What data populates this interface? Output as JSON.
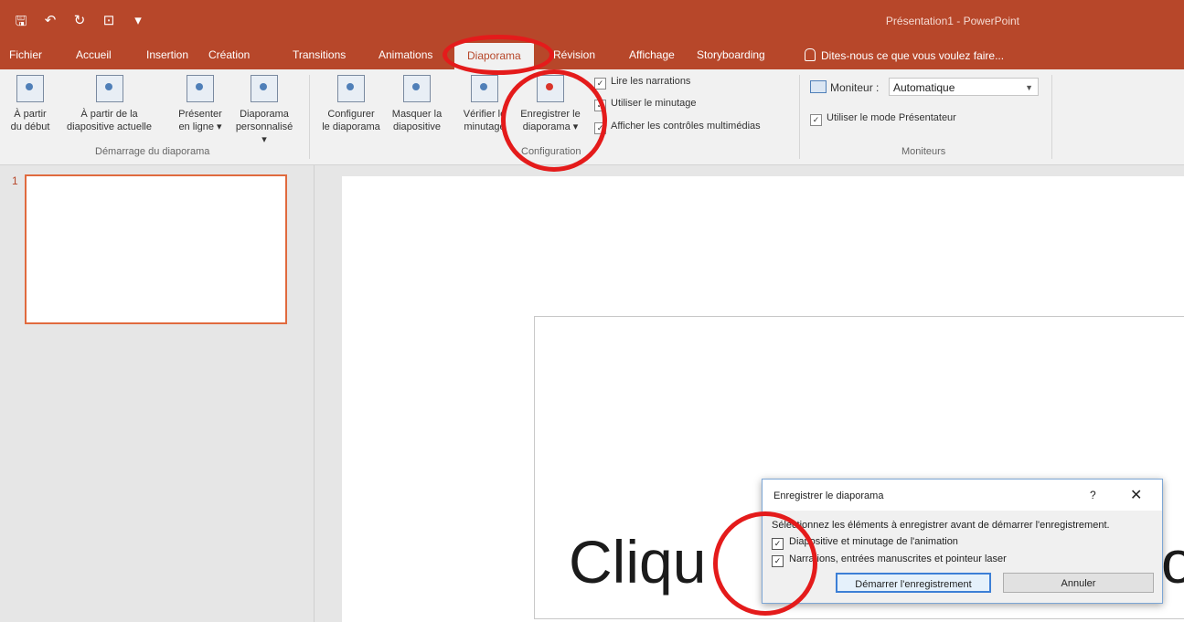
{
  "app": {
    "window_title": "Présentation1 - PowerPoint"
  },
  "qat": {
    "save_icon": "save-icon",
    "undo_icon": "undo-icon",
    "redo_icon": "redo-icon",
    "present_icon": "present-icon",
    "customize_icon": "chevron-down-icon"
  },
  "tabs": [
    "Fichier",
    "Accueil",
    "Insertion",
    "Création",
    "Transitions",
    "Animations",
    "Diaporama",
    "Révision",
    "Affichage",
    "Storyboarding"
  ],
  "active_tab": "Diaporama",
  "tell_me": "Dites-nous ce que vous voulez faire...",
  "ribbon": {
    "start_group": {
      "label": "Démarrage du diaporama",
      "from_start": [
        "À partir",
        "du début"
      ],
      "from_current": [
        "À partir de la",
        "diapositive actuelle"
      ],
      "online": [
        "Présenter",
        "en ligne ▾"
      ],
      "custom": [
        "Diaporama",
        "personnalisé ▾"
      ]
    },
    "config_group": {
      "label": "Configuration",
      "setup": [
        "Configurer",
        "le diaporama"
      ],
      "hide": [
        "Masquer la",
        "diapositive"
      ],
      "rehearse": [
        "Vérifier le",
        "minutage"
      ],
      "record": [
        "Enregistrer le",
        "diaporama ▾"
      ],
      "checks": [
        "Lire les narrations",
        "Utiliser le minutage",
        "Afficher les contrôles multimédias"
      ]
    },
    "monitors_group": {
      "label": "Moniteurs",
      "monitor_label": "Moniteur :",
      "monitor_value": "Automatique",
      "presenter_view": "Utiliser le mode Présentateur"
    }
  },
  "slides": {
    "number": "1"
  },
  "slide_text": {
    "left": "Cliqu",
    "right": "o"
  },
  "dialog": {
    "title": "Enregistrer le diaporama",
    "help": "?",
    "close": "✕",
    "instruction": "Sélectionnez les éléments à enregistrer avant de démarrer l'enregistrement.",
    "options": [
      "Diapositive et minutage de l'animation",
      "Narrations, entrées manuscrites et pointeur laser"
    ],
    "start_button": "Démarrer l'enregistrement",
    "cancel_button": "Annuler"
  },
  "colors": {
    "accent": "#b7472a",
    "annotation": "#e41b1b"
  }
}
